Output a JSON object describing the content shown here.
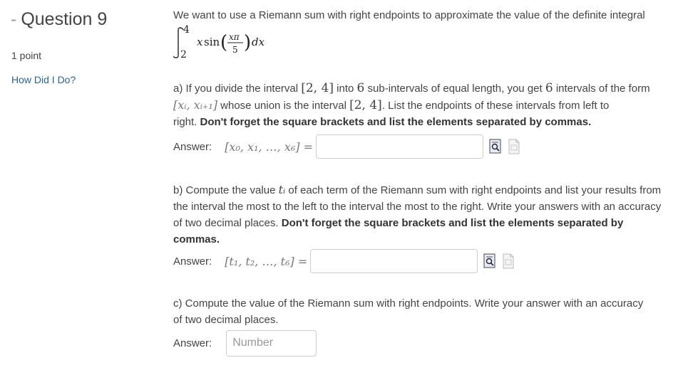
{
  "sidebar": {
    "dash": "-",
    "question_title": "Question 9",
    "points": "1 point",
    "how_did_i_do": "How Did I Do?"
  },
  "problem": {
    "intro": "We want to use a Riemann sum with right endpoints to approximate the value of the definite integral",
    "integral": {
      "lower": "2",
      "upper": "4",
      "var": "x",
      "func": "sin",
      "num": "xπ",
      "den": "5",
      "d": "dx"
    }
  },
  "part_a": {
    "t1": "a) If you divide the interval ",
    "m1": "[2, 4]",
    "t2": " into ",
    "m2": "6",
    "t3": " sub-intervals of equal length, you get ",
    "m3": "6",
    "t4": " intervals of the form",
    "m4": "[xᵢ, xᵢ₊₁]",
    "t5": " whose union is the interval ",
    "m5": "[2, 4]",
    "t6": ". List the endpoints of these intervals from left to",
    "t7": "right. ",
    "bold": "Don't forget the square brackets and list the elements separated by commas.",
    "answer_label": "Answer:",
    "answer_math": "[x₀, x₁, …, x₆] =",
    "answer_value": ""
  },
  "part_b": {
    "t1": "b) Compute the value ",
    "m1": "tᵢ",
    "t2": " of each term of the Riemann sum with right endpoints and list your results from",
    "line2": "the interval the most to the left to the interval the most to the right. Write your answers with an accuracy",
    "line3a": "of two decimal places. ",
    "bold1": "Don't forget the square brackets and list the elements separated by",
    "bold2": "commas.",
    "answer_label": "Answer:",
    "answer_math": "[t₁, t₂, …, t₆] =",
    "answer_value": ""
  },
  "part_c": {
    "line1": "c) Compute the value of the Riemann sum with right endpoints. Write your answer with an accuracy",
    "line2": "of two decimal places.",
    "answer_label": "Answer:",
    "placeholder": "Number"
  },
  "icons": [
    "preview-icon",
    "help-document-icon"
  ]
}
